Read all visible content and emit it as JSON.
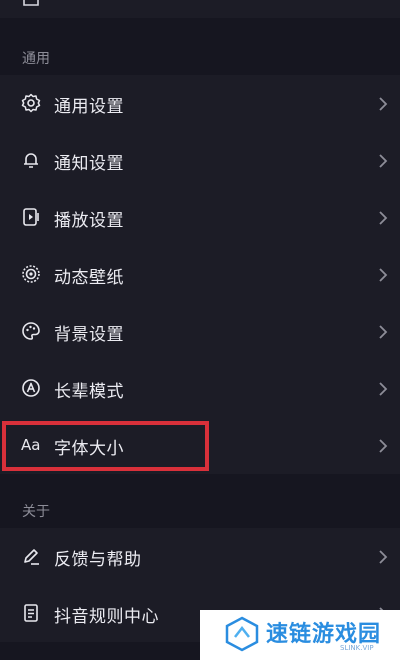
{
  "sections": [
    {
      "label": "通用",
      "items": [
        {
          "label": "通用设置",
          "icon": "gear-icon"
        },
        {
          "label": "通知设置",
          "icon": "bell-icon"
        },
        {
          "label": "播放设置",
          "icon": "play-settings-icon"
        },
        {
          "label": "动态壁纸",
          "icon": "dynamic-wallpaper-icon"
        },
        {
          "label": "背景设置",
          "icon": "palette-icon"
        },
        {
          "label": "长辈模式",
          "icon": "elder-mode-icon"
        },
        {
          "label": "字体大小",
          "icon": "font-size-icon",
          "icon_text": "Aa"
        }
      ]
    },
    {
      "label": "关于",
      "items": [
        {
          "label": "反馈与帮助",
          "icon": "pen-icon"
        },
        {
          "label": "抖音规则中心",
          "icon": "document-icon"
        }
      ]
    }
  ],
  "watermark": {
    "title": "速链游戏园",
    "subtitle": "SLINK.VIP"
  },
  "colors": {
    "background": "#161620",
    "item_background": "#1c1c26",
    "highlight": "#d9303a",
    "watermark_blue": "#2a8de0"
  }
}
